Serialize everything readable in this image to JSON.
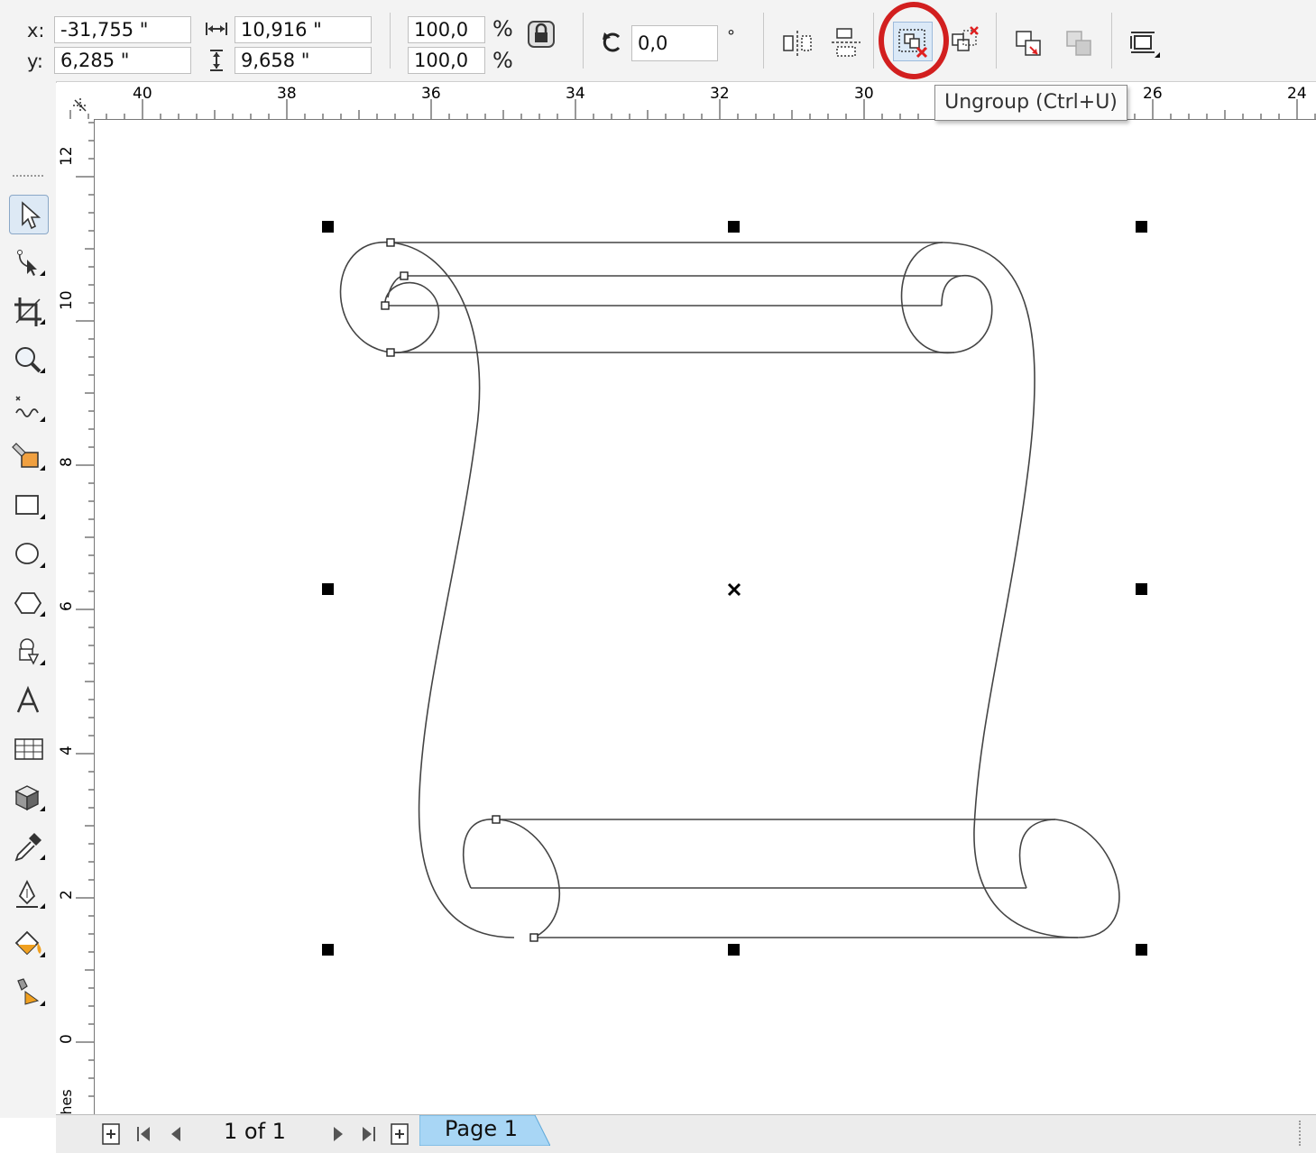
{
  "property_bar": {
    "x_label": "x:",
    "y_label": "y:",
    "x_value": "-31,755 \"",
    "y_value": "6,285 \"",
    "width_value": "10,916 \"",
    "height_value": "9,658 \"",
    "scale_x": "100,0",
    "scale_y": "100,0",
    "percent_x": "%",
    "percent_y": "%",
    "rotation": "0,0",
    "degree": "°"
  },
  "tooltip": "Ungroup (Ctrl+U)",
  "ruler": {
    "h_ticks": [
      "40",
      "38",
      "36",
      "34",
      "32",
      "30",
      "26",
      "24"
    ],
    "v_ticks": [
      "12",
      "10",
      "8",
      "6",
      "4",
      "2",
      "0"
    ],
    "units": "inches"
  },
  "status": {
    "page_count": "1 of 1",
    "page_tab": "Page 1"
  },
  "colors": {
    "highlight_circle": "#d21f1f",
    "page_tab": "#a8d6f5"
  }
}
